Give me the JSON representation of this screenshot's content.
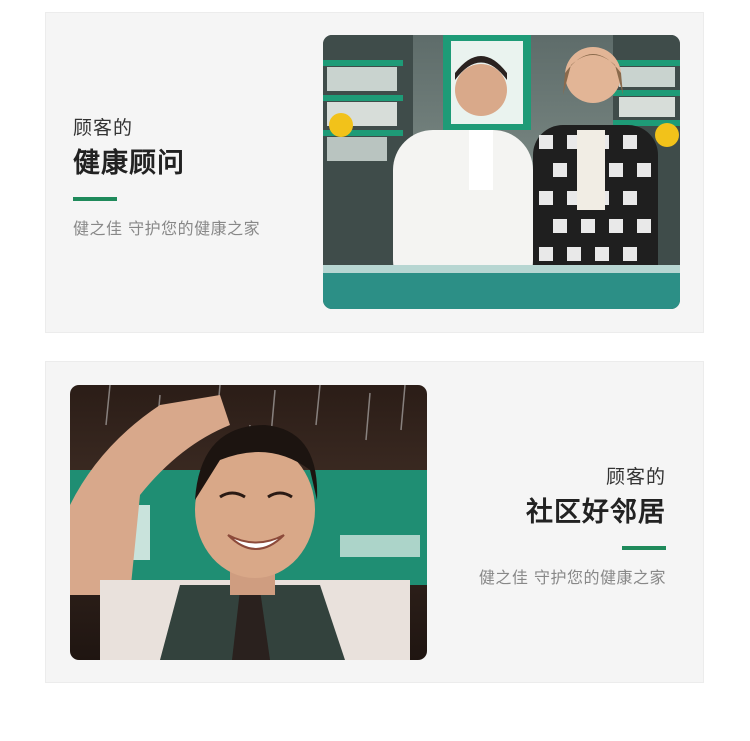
{
  "theme": {
    "accent": "#1f8a5b",
    "card_bg": "#f5f5f5",
    "brand_green": "#1e9b77"
  },
  "sections": [
    {
      "pretitle": "顾客的",
      "title": "健康顾问",
      "subtitle": "健之佳 守护您的健康之家",
      "photo_subject": "pharmacist-and-customer-photo"
    },
    {
      "pretitle": "顾客的",
      "title": "社区好邻居",
      "subtitle": "健之佳 守护您的健康之家",
      "photo_subject": "smiling-staff-in-rain-photo"
    }
  ]
}
